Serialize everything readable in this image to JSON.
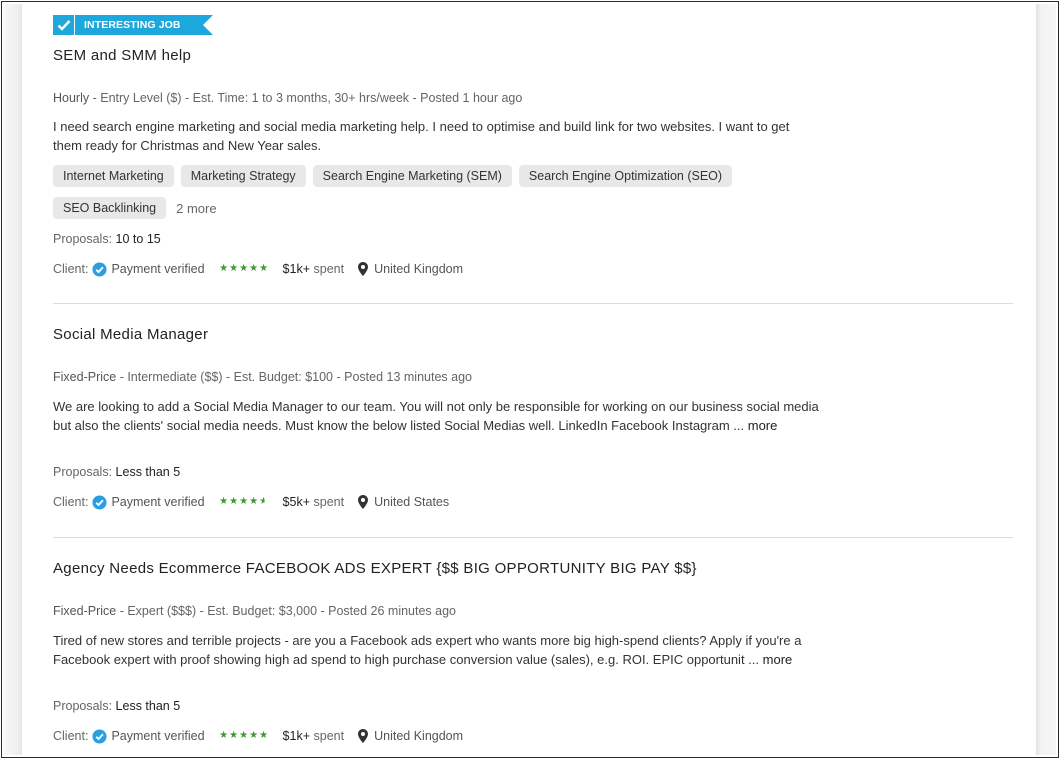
{
  "colors": {
    "badge_blue": "#1ea7dd",
    "star_green": "#3c9a2e",
    "verified_blue": "#2a9fe0"
  },
  "jobs": [
    {
      "badge": {
        "label": "INTERESTING JOB",
        "icon": "check-icon"
      },
      "title": "SEM and SMM help",
      "meta": {
        "type": "Hourly",
        "level": "Entry Level ($)",
        "estimate": "Est. Time: 1 to 3 months, 30+ hrs/week",
        "posted": "Posted 1 hour ago"
      },
      "description": "I need search engine marketing and social media marketing help. I need to optimise and build link for two websites. I want to get them ready for Christmas and New Year sales.",
      "more_label": "",
      "skills": [
        "Internet Marketing",
        "Marketing Strategy",
        "Search Engine Marketing (SEM)",
        "Search Engine Optimization (SEO)",
        "SEO Backlinking"
      ],
      "skills_more": "2 more",
      "proposals_label": "Proposals:",
      "proposals": "10 to 15",
      "client": {
        "label": "Client:",
        "payment": "Payment verified",
        "rating": 5,
        "rating_max": 5,
        "spent_amount": "$1k+",
        "spent_label": "spent",
        "location": "United Kingdom"
      }
    },
    {
      "title": "Social Media Manager",
      "meta": {
        "type": "Fixed-Price",
        "level": "Intermediate ($$)",
        "estimate": "Est. Budget: $100",
        "posted": "Posted 13 minutes ago"
      },
      "description": "We are looking to add a Social Media Manager to our team. You will not only be responsible for working on our business social media but also the clients' social media needs. Must know the below listed Social Medias well. LinkedIn Facebook Instagram ...",
      "more_label": "more",
      "proposals_label": "Proposals:",
      "proposals": "Less than 5",
      "client": {
        "label": "Client:",
        "payment": "Payment verified",
        "rating": 4.5,
        "rating_max": 5,
        "spent_amount": "$5k+",
        "spent_label": "spent",
        "location": "United States"
      }
    },
    {
      "title": "Agency Needs Ecommerce FACEBOOK ADS EXPERT {$$ BIG OPPORTUNITY BIG PAY $$}",
      "meta": {
        "type": "Fixed-Price",
        "level": "Expert ($$$)",
        "estimate": "Est. Budget: $3,000",
        "posted": "Posted 26 minutes ago"
      },
      "description": "Tired of new stores and terrible projects - are you a Facebook ads expert who wants more big high-spend clients? Apply if you're a Facebook expert with proof showing high ad spend to high purchase conversion value (sales), e.g. ROI. EPIC opportunit ...",
      "more_label": "more",
      "proposals_label": "Proposals:",
      "proposals": "Less than 5",
      "client": {
        "label": "Client:",
        "payment": "Payment verified",
        "rating": 5,
        "rating_max": 5,
        "spent_amount": "$1k+",
        "spent_label": "spent",
        "location": "United Kingdom"
      }
    }
  ],
  "separator": " - "
}
